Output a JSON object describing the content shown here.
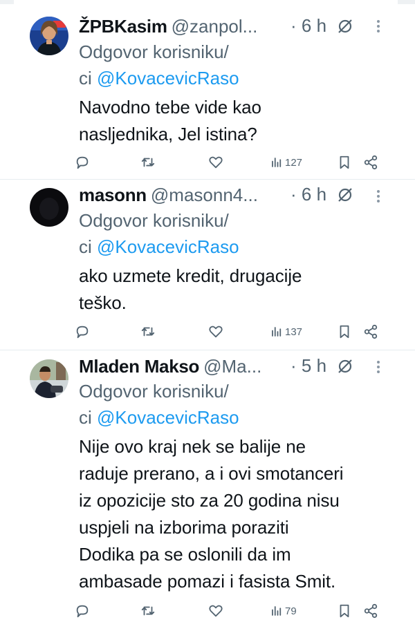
{
  "tweets": [
    {
      "name": "ŽPBKasim",
      "handle": "@zanpol...",
      "time": "· 6 h",
      "reply_prefix": "Odgovor korisniku/",
      "reply_ci": "ci ",
      "reply_mention": "@KovacevicRaso",
      "body_lines": [
        "Navodno tebe vide kao",
        "nasljednika, Jel istina?"
      ],
      "views": "127"
    },
    {
      "name": "masonn",
      "handle": "@masonn4...",
      "time": "· 6 h",
      "reply_prefix": "Odgovor korisniku/",
      "reply_ci": "ci ",
      "reply_mention": "@KovacevicRaso",
      "body_lines": [
        "ako uzmete kredit, drugacije",
        "teško."
      ],
      "views": "137"
    },
    {
      "name": "Mladen Makso",
      "handle": "@Ma...",
      "time": "· 5 h",
      "reply_prefix": "Odgovor korisniku/",
      "reply_ci": "ci ",
      "reply_mention": "@KovacevicRaso",
      "body_lines": [
        "Nije ovo kraj nek se balije ne",
        "raduje prerano, a i ovi smotanceri",
        "iz opozicije sto za 20 godina nisu",
        "uspjeli na izborima poraziti",
        "Dodika pa se oslonili da im",
        "ambasade pomazi i fasista Smit."
      ],
      "views": "79"
    }
  ],
  "colors": {
    "text": "#0f1419",
    "secondary": "#536471",
    "mention": "#1d9bf0",
    "divider": "#e6ecf0"
  },
  "icons": [
    "grok-icon",
    "more-icon",
    "reply-icon",
    "retweet-icon",
    "like-icon",
    "views-icon",
    "bookmark-icon",
    "share-icon"
  ]
}
